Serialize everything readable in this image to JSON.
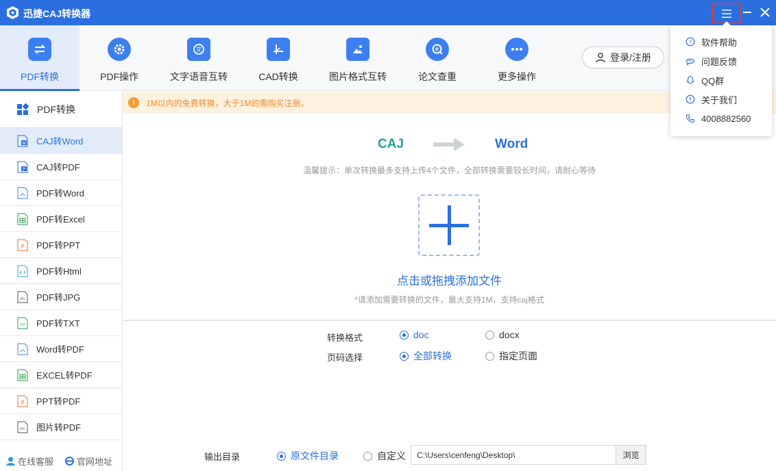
{
  "app": {
    "title": "迅捷CAJ转换器"
  },
  "topnav": {
    "items": [
      {
        "label": "PDF转换",
        "icon": "pdf-convert-icon",
        "active": true
      },
      {
        "label": "PDF操作",
        "icon": "gear-icon"
      },
      {
        "label": "文字语音互转",
        "icon": "text-speech-icon"
      },
      {
        "label": "CAD转换",
        "icon": "cad-icon"
      },
      {
        "label": "图片格式互转",
        "icon": "image-icon"
      },
      {
        "label": "论文查重",
        "icon": "search-doc-icon"
      },
      {
        "label": "更多操作",
        "icon": "more-icon"
      }
    ],
    "login_label": "登录/注册"
  },
  "sidebar": {
    "header": "PDF转换",
    "items": [
      {
        "label": "CAJ转Word",
        "active": true
      },
      {
        "label": "CAJ转PDF"
      },
      {
        "label": "PDF转Word"
      },
      {
        "label": "PDF转Excel"
      },
      {
        "label": "PDF转PPT"
      },
      {
        "label": "PDF转Html"
      },
      {
        "label": "PDF转JPG"
      },
      {
        "label": "PDF转TXT"
      },
      {
        "label": "Word转PDF"
      },
      {
        "label": "EXCEL转PDF"
      },
      {
        "label": "PPT转PDF"
      },
      {
        "label": "图片转PDF"
      }
    ],
    "footer": {
      "service": "在线客服",
      "website": "官网地址"
    }
  },
  "notice": {
    "text": "1M以内的免费转换，大于1M的需购买注册。"
  },
  "converter": {
    "from": "CAJ",
    "to": "Word",
    "tip": "温馨提示：单次转换最多支持上传4个文件，全部转换需要较长时间，请耐心等待",
    "add_label": "点击或拖拽添加文件",
    "add_hint": "*请添加需要转换的文件，最大支持1M，支持caj格式"
  },
  "options": {
    "format_label": "转换格式",
    "formats": [
      "doc",
      "docx"
    ],
    "format_selected": "doc",
    "page_label": "页码选择",
    "pages": [
      "全部转换",
      "指定页面"
    ],
    "page_selected": "全部转换",
    "output_label": "输出目录",
    "outputs": [
      "原文件目录",
      "自定义"
    ],
    "output_selected": "原文件目录",
    "path": "C:\\Users\\cenfeng\\Desktop\\",
    "browse_label": "浏览"
  },
  "menu": {
    "items": [
      {
        "label": "软件帮助",
        "icon": "help-icon"
      },
      {
        "label": "问题反馈",
        "icon": "feedback-icon"
      },
      {
        "label": "QQ群",
        "icon": "qq-icon"
      },
      {
        "label": "关于我们",
        "icon": "info-icon"
      },
      {
        "label": "4008882560",
        "icon": "phone-icon"
      }
    ]
  },
  "colors": {
    "titlebar": "#2a6ee0",
    "accent": "#2a6ee0",
    "teal": "#1aa39a",
    "notice_bg": "#fdf1e0",
    "notice_text": "#f08a24"
  }
}
